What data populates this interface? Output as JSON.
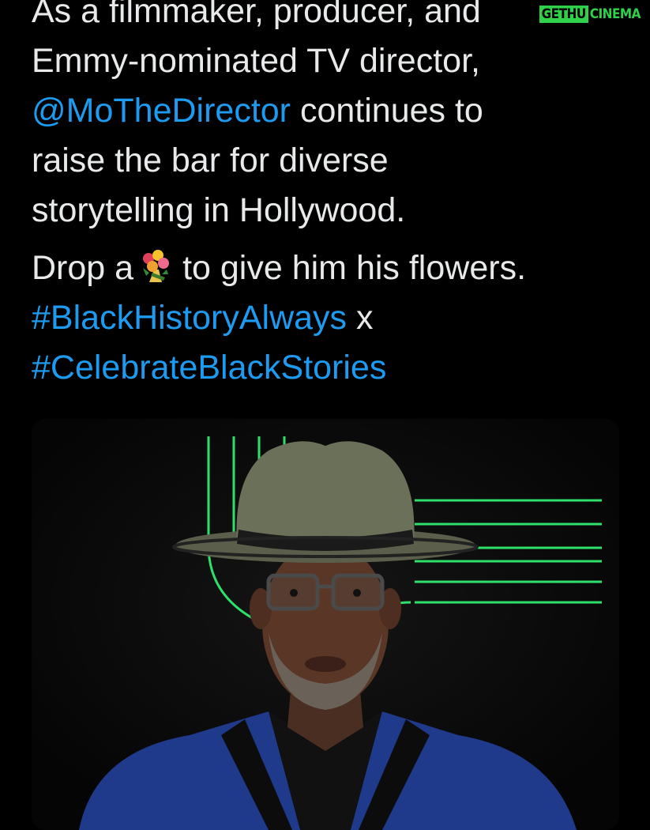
{
  "watermark": {
    "part1": "GETHU",
    "part2": "CINEMA"
  },
  "tweet": {
    "line1": "As a filmmaker, producer, and",
    "line2": "Emmy-nominated TV director,",
    "mention": "@MoTheDirector",
    "line3_rest": " continues to",
    "line4": "raise the bar for diverse",
    "line5": "storytelling in Hollywood.",
    "drop_prefix": "Drop a",
    "drop_suffix": "to give him his flowers.",
    "hashtag1": "#BlackHistoryAlways",
    "separator": " x",
    "hashtag2": "#CelebrateBlackStories",
    "emoji": "bouquet-emoji"
  },
  "media": {
    "description_icon": "portrait-photo",
    "accent_color": "#2ee06a",
    "link_color": "#1d9bf0"
  }
}
